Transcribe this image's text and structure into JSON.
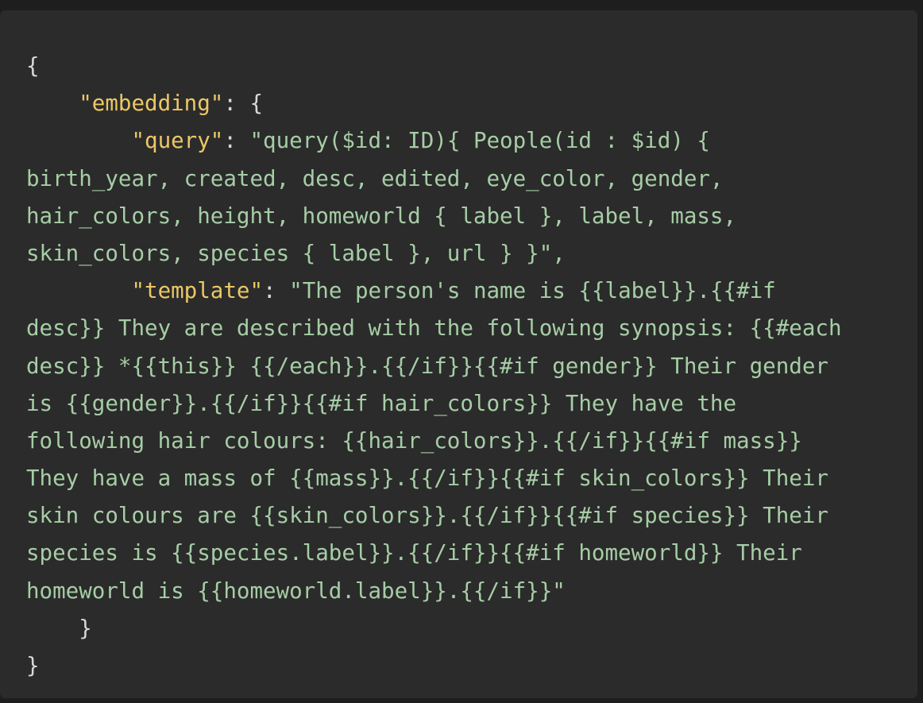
{
  "code": {
    "lines": [
      "{",
      "    ",
      "\"embedding\"",
      ": {",
      "        ",
      "\"query\"",
      ": ",
      "\"query($id: ID){ People(id : $id) {",
      "birth_year, created, desc, edited, eye_color, gender,",
      "hair_colors, height, homeworld { label }, label, mass,",
      "skin_colors, species { label }, url } }\",",
      "        ",
      "\"template\"",
      ": ",
      "\"The person's name is {{label}}.{{#if",
      "desc}} They are described with the following synopsis: {{#each",
      "desc}} *{{this}} {{/each}}.{{/if}}{{#if gender}} Their gender",
      "is {{gender}}.{{/if}}{{#if hair_colors}} They have the",
      "following hair colours: {{hair_colors}}.{{/if}}{{#if mass}}",
      "They have a mass of {{mass}}.{{/if}}{{#if skin_colors}} Their",
      "skin colours are {{skin_colors}}.{{/if}}{{#if species}} Their",
      "species is {{species.label}}.{{/if}}{{#if homeworld}} Their",
      "homeworld is {{homeworld.label}}.{{/if}}\"",
      "    }",
      "}"
    ]
  }
}
